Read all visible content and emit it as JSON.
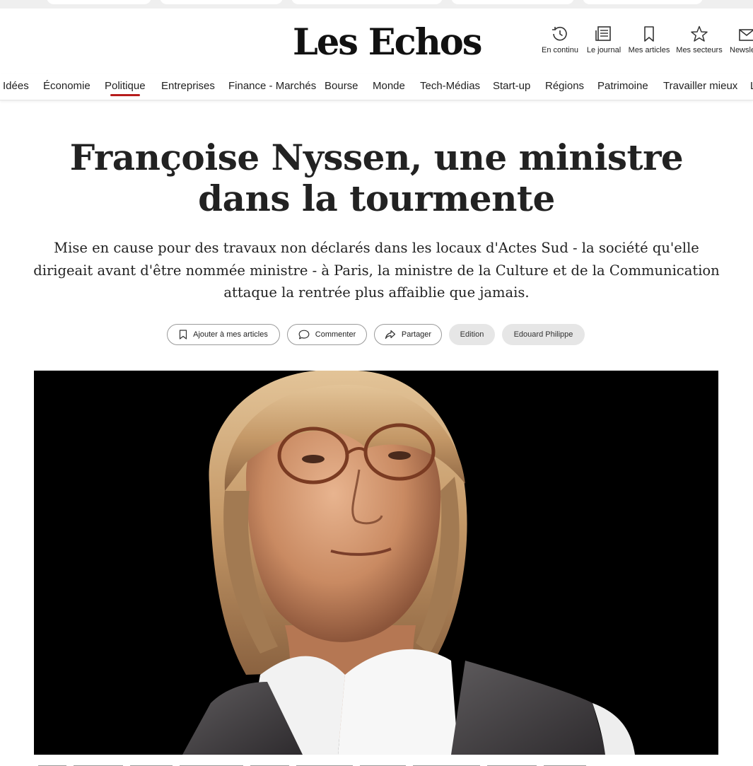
{
  "header": {
    "logo": "Les Echos",
    "tools": [
      {
        "label": "En continu",
        "icon": "history-clock-icon"
      },
      {
        "label": "Le journal",
        "icon": "newspaper-icon"
      },
      {
        "label": "Mes articles",
        "icon": "bookmark-icon"
      },
      {
        "label": "Mes secteurs",
        "icon": "star-icon"
      },
      {
        "label": "Newsle",
        "icon": "envelope-icon"
      }
    ]
  },
  "nav": {
    "active": "Politique",
    "accent_color": "#b71c1c",
    "items": [
      "Idées",
      "Économie",
      "Politique",
      "Entreprises",
      "Finance - Marchés",
      "Bourse",
      "Monde",
      "Tech-Médias",
      "Start-up",
      "Régions",
      "Patrimoine",
      "Travailler mieux",
      "L"
    ]
  },
  "article": {
    "title": "Françoise Nyssen, une ministre dans la tourmente",
    "lead": "Mise en cause pour des travaux non déclarés dans les locaux d'Actes Sud - la société qu'elle dirigeait avant d'être nommée ministre - à Paris, la ministre de la Culture et de la Communication attaque la rentrée plus affaiblie que jamais.",
    "actions": {
      "save_label": "Ajouter à mes articles",
      "comment_label": "Commenter",
      "share_label": "Partager"
    },
    "tags": [
      "Edition",
      "Edouard Philippe"
    ]
  }
}
